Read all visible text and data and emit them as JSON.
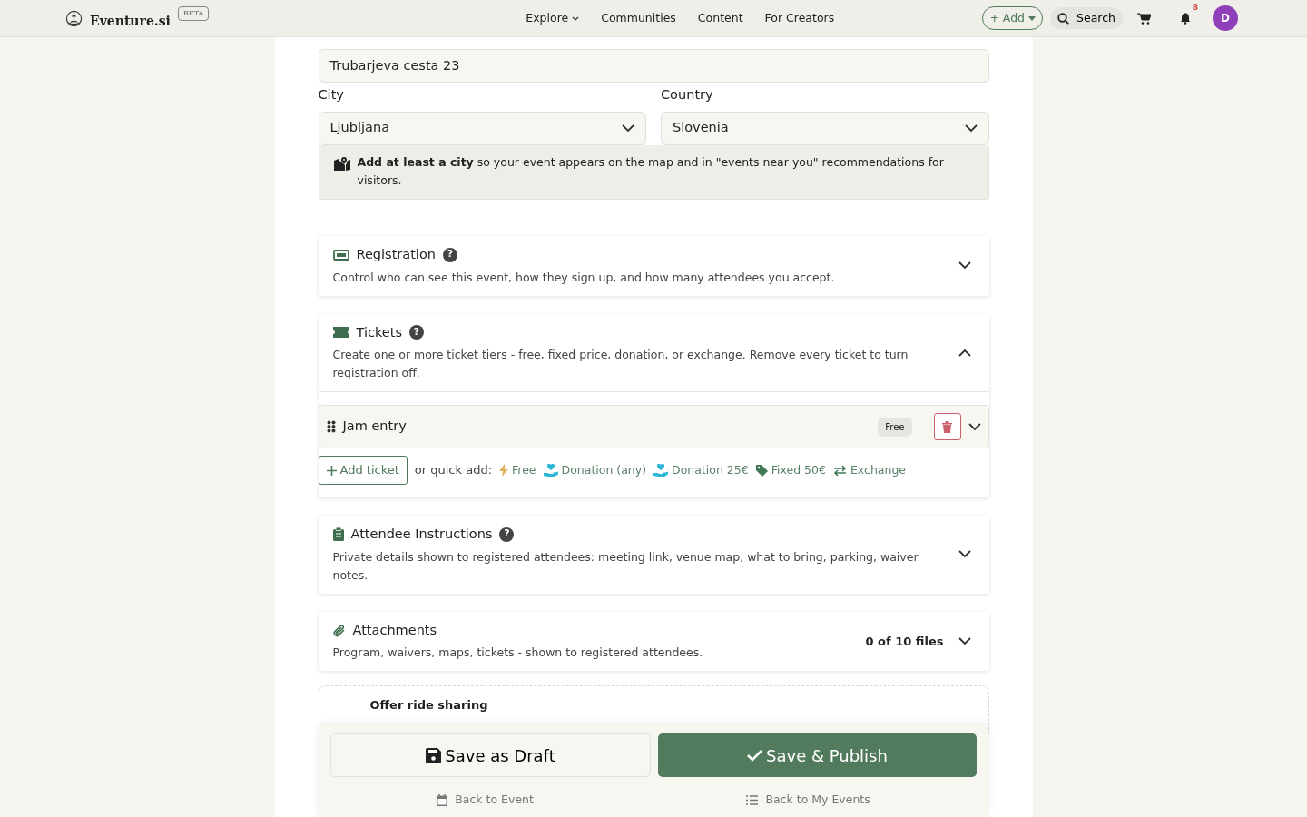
{
  "nav": {
    "brand": "Eventure.si",
    "beta": "BETA",
    "links": [
      {
        "label": "Explore",
        "dropdown": true
      },
      {
        "label": "Communities",
        "dropdown": false
      },
      {
        "label": "Content",
        "dropdown": false
      },
      {
        "label": "For Creators",
        "dropdown": false
      }
    ],
    "add_button": "+ Add",
    "search": "Search",
    "notification_count": "8",
    "avatar": "D"
  },
  "location": {
    "address": "Trubarjeva cesta 23",
    "city_label": "City",
    "city": "Ljubljana",
    "country_label": "Country",
    "country": "Slovenia",
    "hint": "**Add at least a city** so your event appears on the map and in \"events near you\" recommendations for visitors."
  },
  "sections": [
    {
      "kind": "registration",
      "title": "Registration",
      "help": "?",
      "description": "Control who can see this event, how they sign up, and how many attendees you accept.",
      "expanded": false
    },
    {
      "kind": "tickets",
      "title": "Tickets",
      "help": "?",
      "description": "Create one or more ticket tiers - free, fixed price, donation, or exchange. Remove every ticket to turn registration off.",
      "expanded": true,
      "items": [
        {
          "name": "Jam entry",
          "badge": "Free"
        }
      ],
      "add_button": "Add ticket",
      "quick_add_label": "or quick add:",
      "quick_add": [
        {
          "kind": "free",
          "label": "Free"
        },
        {
          "kind": "donation",
          "label": "Donation (any)"
        },
        {
          "kind": "donation",
          "label": "Donation 25€"
        },
        {
          "kind": "fixed",
          "label": "Fixed 50€"
        },
        {
          "kind": "exchange",
          "label": "Exchange"
        }
      ]
    },
    {
      "kind": "instructions",
      "title": "Attendee Instructions",
      "help": "?",
      "description": "Private details shown to registered attendees: meeting link, venue map, what to bring, parking, waiver notes.",
      "expanded": false
    },
    {
      "kind": "attachments",
      "title": "Attachments",
      "count": "0 of 10 files",
      "description": "Program, waivers, maps, tickets - shown to registered attendees.",
      "expanded": false
    }
  ],
  "ride_sharing": {
    "title": "Offer ride sharing"
  },
  "footer": {
    "draft": "Save as Draft",
    "publish": "Save & Publish",
    "back_event": "Back to Event",
    "back_list": "Back to My Events"
  }
}
